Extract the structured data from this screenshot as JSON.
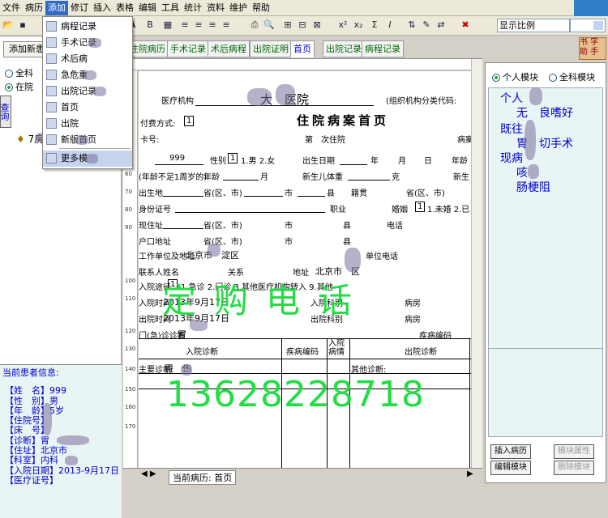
{
  "menubar": {
    "items": [
      "文件",
      "病历",
      "添加",
      "修订",
      "插入",
      "表格",
      "编辑",
      "工具",
      "统计",
      "资料",
      "维护",
      "帮助"
    ],
    "active_index": 2
  },
  "toolbar": {
    "zoom_label": "显示比例"
  },
  "add_menu": {
    "items": [
      "病程记录",
      "手术记录",
      "术后病",
      "急危重",
      "出院记录",
      "首页",
      "出院",
      "新版首页",
      "更多模"
    ]
  },
  "left": {
    "new_button": "添加新患",
    "radio_all": "全科",
    "radio_in": "在院",
    "query_button": "查询",
    "tree_item": "7房"
  },
  "patient_info": {
    "heading": "当前患者信息:",
    "lines": [
      "【姓　名】999",
      "【性　别】男",
      "【年　龄】5岁",
      "【住院号】",
      "【床　号】",
      "【诊断】胃",
      "【住址】北京市",
      "【科室】内科",
      "【入院日期】2013-9月17日",
      "【医疗证号】"
    ]
  },
  "tabs": [
    "住院病历",
    "手术记录",
    "术后病程",
    "出院证明",
    "首页",
    "出院记录",
    "病程记录"
  ],
  "selected_tab": "首页",
  "right": {
    "radio_personal": "个人模块",
    "radio_all": "全科模块",
    "tree": [
      "个人",
      "无　良嗜好",
      "既往",
      "胃　切手术",
      "现病",
      "咳",
      "肠梗阻"
    ],
    "insert_button": "插入病历",
    "property_button": "模块属性",
    "edit_button": "编辑模块",
    "delete_button": "删除模块",
    "corner_labels": [
      "书",
      "字",
      "助",
      "手"
    ]
  },
  "doc": {
    "org_label": "医疗机构",
    "hospital": "大　医院",
    "org_code_label": "(组织机构分类代码:",
    "payment_label": "付费方式:",
    "payment_value": "1",
    "title": "住院病案首页",
    "card_label": "卡号:",
    "times_label": "第　次住院",
    "case_label": "病案",
    "name_value": "999",
    "gender_label": "性别",
    "gender_value": "1",
    "gender_options": "1.男 2.女",
    "birth_label": "出生日期",
    "year": "年",
    "month": "月",
    "day": "日",
    "age_label": "年龄",
    "infant_label": "(年龄不足1周岁的)",
    "infant_age": "年龄",
    "newborn_weight": "新生儿体重",
    "gram": "克",
    "newborn_label": "新生",
    "birthplace": "出生地",
    "province": "省(区、市)",
    "city": "市",
    "county": "县",
    "native": "籍贯",
    "id_label": "身份证号",
    "job": "职业",
    "marriage": "婚姻",
    "marriage_value": "1",
    "marriage_options": "1.未婚 2.已",
    "address": "现住址",
    "phone": "电话",
    "hukou": "户口地址",
    "workplace": "工作单位及地址",
    "work_value": "北京市　淀区",
    "work_phone": "单位电话",
    "contact": "联系人姓名",
    "relation": "关系",
    "contact_address": "地址",
    "contact_value": "北京市　区",
    "admit_route": "入院途径",
    "route_value": "1",
    "route_options": "1.急诊 2.门诊 3.其他医疗机构转入 9.其他",
    "admit_time": "入院时间",
    "admit_date": "2013年9月17日",
    "admit_dept": "入院科别",
    "ward": "病房",
    "discharge_time": "出院时间",
    "discharge_date": "2013年9月17日",
    "discharge_dept": "出院科别",
    "clinic_diag": "门(急)诊诊断",
    "clinic_value": "胃",
    "disease_code": "疾病编码",
    "table_headers": [
      "入院诊断",
      "疾病编码",
      "入院病情",
      "出院诊断"
    ],
    "main_diag": "主要诊断:",
    "main_value": "胃　伤",
    "other_diag": "其他诊断:",
    "watermark_text": "定购电话",
    "watermark_phone": "13628228718"
  },
  "bottom": {
    "current_label": "当前病历:",
    "current_value": "首页"
  }
}
